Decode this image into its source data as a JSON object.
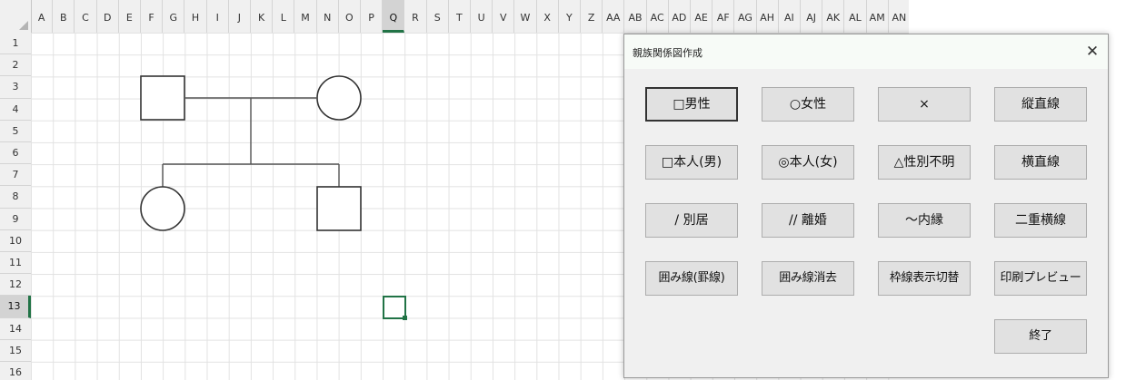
{
  "sheet": {
    "columns": [
      "A",
      "B",
      "C",
      "D",
      "E",
      "F",
      "G",
      "H",
      "I",
      "J",
      "K",
      "L",
      "M",
      "N",
      "O",
      "P",
      "Q",
      "R",
      "S",
      "T",
      "U",
      "V",
      "W",
      "X",
      "Y",
      "Z",
      "AA",
      "AB",
      "AC",
      "AD",
      "AE",
      "AF",
      "AG",
      "AH",
      "AI",
      "AJ",
      "AK",
      "AL",
      "AM",
      "AN"
    ],
    "rows": [
      "1",
      "2",
      "3",
      "4",
      "5",
      "6",
      "7",
      "8",
      "9",
      "10",
      "11",
      "12",
      "13",
      "14",
      "15",
      "16"
    ],
    "active_column": "Q",
    "active_row": "13",
    "colors": {
      "selection": "#217346",
      "gridline": "#e2e2e2",
      "header_bg": "#f0f0f0",
      "shape_stroke": "#333333"
    }
  },
  "dialog": {
    "title": "親族関係図作成",
    "close_label": "✕",
    "buttons": [
      {
        "name": "male-button",
        "label": "□男性"
      },
      {
        "name": "female-button",
        "label": "○女性"
      },
      {
        "name": "cross-button",
        "label": "×"
      },
      {
        "name": "vertical-line-button",
        "label": "縦直線"
      },
      {
        "name": "self-male-button",
        "label": "□本人(男)"
      },
      {
        "name": "self-female-button",
        "label": "◎本人(女)"
      },
      {
        "name": "unknown-sex-button",
        "label": "△性別不明"
      },
      {
        "name": "horizontal-line-button",
        "label": "横直線"
      },
      {
        "name": "separation-button",
        "label": "/ 別居"
      },
      {
        "name": "divorce-button",
        "label": "// 離婚"
      },
      {
        "name": "common-law-button",
        "label": "～内縁"
      },
      {
        "name": "double-horizontal-line-button",
        "label": "二重横線"
      },
      {
        "name": "border-enclose-button",
        "label": "囲み線(罫線)"
      },
      {
        "name": "border-clear-button",
        "label": "囲み線消去"
      },
      {
        "name": "gridline-toggle-button",
        "label": "枠線表示切替"
      },
      {
        "name": "print-preview-button",
        "label": "印刷プレビュー"
      },
      {
        "name": "exit-button",
        "label": "終了"
      }
    ]
  }
}
